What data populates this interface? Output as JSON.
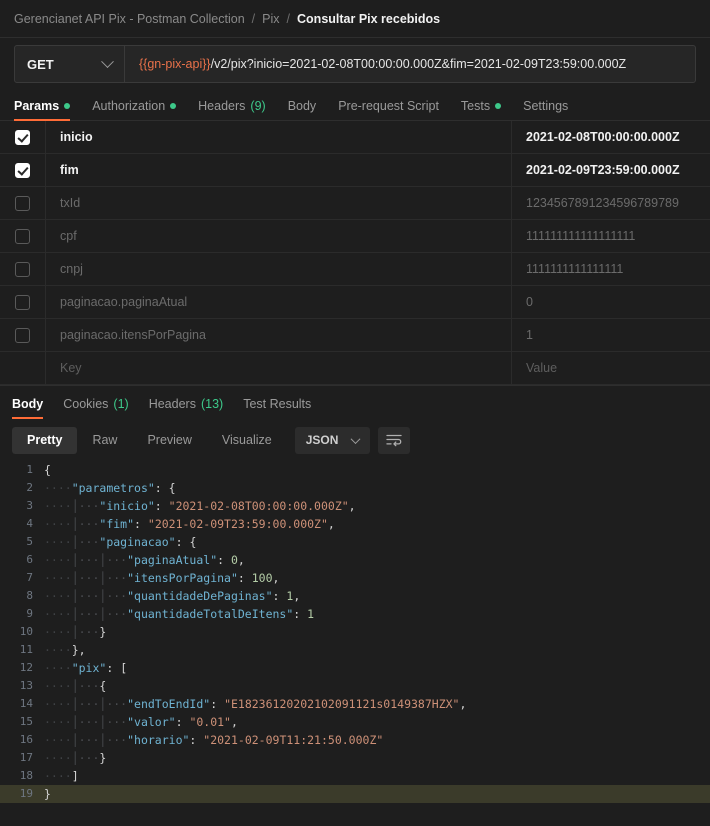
{
  "breadcrumb": {
    "collection": "Gerencianet API Pix - Postman Collection",
    "folder": "Pix",
    "request": "Consultar Pix recebidos",
    "separator": "/"
  },
  "request_bar": {
    "method": "GET",
    "url_variable": "{{gn-pix-api}}",
    "url_path": "/v2/pix?inicio=2021-02-08T00:00:00.000Z&fim=2021-02-09T23:59:00.000Z",
    "accent_color": "#ff6c37",
    "variable_color": "#e8714a"
  },
  "request_tabs": [
    {
      "label": "Params",
      "dot": true,
      "count": "",
      "active": true
    },
    {
      "label": "Authorization",
      "dot": true,
      "count": "",
      "active": false
    },
    {
      "label": "Headers",
      "dot": false,
      "count": "(9)",
      "active": false
    },
    {
      "label": "Body",
      "dot": false,
      "count": "",
      "active": false
    },
    {
      "label": "Pre-request Script",
      "dot": false,
      "count": "",
      "active": false
    },
    {
      "label": "Tests",
      "dot": true,
      "count": "",
      "active": false
    },
    {
      "label": "Settings",
      "dot": false,
      "count": "",
      "active": false
    }
  ],
  "params_table": {
    "rows": [
      {
        "checked": true,
        "key": "inicio",
        "value": "2021-02-08T00:00:00.000Z",
        "enabled": true
      },
      {
        "checked": true,
        "key": "fim",
        "value": "2021-02-09T23:59:00.000Z",
        "enabled": true
      },
      {
        "checked": false,
        "key": "txId",
        "value": "1234567891234596789789",
        "enabled": false
      },
      {
        "checked": false,
        "key": "cpf",
        "value": "111111111111111111",
        "enabled": false
      },
      {
        "checked": false,
        "key": "cnpj",
        "value": "1111111111111111",
        "enabled": false
      },
      {
        "checked": false,
        "key": "paginacao.paginaAtual",
        "value": "0",
        "enabled": false
      },
      {
        "checked": false,
        "key": "paginacao.itensPorPagina",
        "value": "1",
        "enabled": false
      }
    ],
    "placeholder_row": {
      "key": "Key",
      "value": "Value"
    }
  },
  "response_tabs": [
    {
      "label": "Body",
      "count": "",
      "active": true
    },
    {
      "label": "Cookies",
      "count": "(1)",
      "active": false
    },
    {
      "label": "Headers",
      "count": "(13)",
      "active": false
    },
    {
      "label": "Test Results",
      "count": "",
      "active": false
    }
  ],
  "body_toolbar": {
    "views": [
      {
        "label": "Pretty",
        "active": true
      },
      {
        "label": "Raw",
        "active": false
      },
      {
        "label": "Preview",
        "active": false
      },
      {
        "label": "Visualize",
        "active": false
      }
    ],
    "format": "JSON",
    "wrap_icon": "word-wrap-icon"
  },
  "response_body": {
    "language": "json",
    "active_line": 19,
    "lines": [
      {
        "n": 1,
        "indent": 0,
        "tokens": [
          {
            "t": "brace",
            "v": "{"
          }
        ]
      },
      {
        "n": 2,
        "indent": 1,
        "tokens": [
          {
            "t": "key",
            "v": "\"parametros\""
          },
          {
            "t": "punc",
            "v": ": "
          },
          {
            "t": "brace",
            "v": "{"
          }
        ]
      },
      {
        "n": 3,
        "indent": 2,
        "tokens": [
          {
            "t": "key",
            "v": "\"inicio\""
          },
          {
            "t": "punc",
            "v": ": "
          },
          {
            "t": "str",
            "v": "\"2021-02-08T00:00:00.000Z\""
          },
          {
            "t": "punc",
            "v": ","
          }
        ]
      },
      {
        "n": 4,
        "indent": 2,
        "tokens": [
          {
            "t": "key",
            "v": "\"fim\""
          },
          {
            "t": "punc",
            "v": ": "
          },
          {
            "t": "str",
            "v": "\"2021-02-09T23:59:00.000Z\""
          },
          {
            "t": "punc",
            "v": ","
          }
        ]
      },
      {
        "n": 5,
        "indent": 2,
        "tokens": [
          {
            "t": "key",
            "v": "\"paginacao\""
          },
          {
            "t": "punc",
            "v": ": "
          },
          {
            "t": "brace",
            "v": "{"
          }
        ]
      },
      {
        "n": 6,
        "indent": 3,
        "tokens": [
          {
            "t": "key",
            "v": "\"paginaAtual\""
          },
          {
            "t": "punc",
            "v": ": "
          },
          {
            "t": "num",
            "v": "0"
          },
          {
            "t": "punc",
            "v": ","
          }
        ]
      },
      {
        "n": 7,
        "indent": 3,
        "tokens": [
          {
            "t": "key",
            "v": "\"itensPorPagina\""
          },
          {
            "t": "punc",
            "v": ": "
          },
          {
            "t": "num",
            "v": "100"
          },
          {
            "t": "punc",
            "v": ","
          }
        ]
      },
      {
        "n": 8,
        "indent": 3,
        "tokens": [
          {
            "t": "key",
            "v": "\"quantidadeDePaginas\""
          },
          {
            "t": "punc",
            "v": ": "
          },
          {
            "t": "num",
            "v": "1"
          },
          {
            "t": "punc",
            "v": ","
          }
        ]
      },
      {
        "n": 9,
        "indent": 3,
        "tokens": [
          {
            "t": "key",
            "v": "\"quantidadeTotalDeItens\""
          },
          {
            "t": "punc",
            "v": ": "
          },
          {
            "t": "num",
            "v": "1"
          }
        ]
      },
      {
        "n": 10,
        "indent": 2,
        "tokens": [
          {
            "t": "brace",
            "v": "}"
          }
        ]
      },
      {
        "n": 11,
        "indent": 1,
        "tokens": [
          {
            "t": "brace",
            "v": "}"
          },
          {
            "t": "punc",
            "v": ","
          }
        ]
      },
      {
        "n": 12,
        "indent": 1,
        "tokens": [
          {
            "t": "key",
            "v": "\"pix\""
          },
          {
            "t": "punc",
            "v": ": "
          },
          {
            "t": "brace",
            "v": "["
          }
        ]
      },
      {
        "n": 13,
        "indent": 2,
        "tokens": [
          {
            "t": "brace",
            "v": "{"
          }
        ]
      },
      {
        "n": 14,
        "indent": 3,
        "tokens": [
          {
            "t": "key",
            "v": "\"endToEndId\""
          },
          {
            "t": "punc",
            "v": ": "
          },
          {
            "t": "str",
            "v": "\"E18236120202102091121s0149387HZX\""
          },
          {
            "t": "punc",
            "v": ","
          }
        ]
      },
      {
        "n": 15,
        "indent": 3,
        "tokens": [
          {
            "t": "key",
            "v": "\"valor\""
          },
          {
            "t": "punc",
            "v": ": "
          },
          {
            "t": "str",
            "v": "\"0.01\""
          },
          {
            "t": "punc",
            "v": ","
          }
        ]
      },
      {
        "n": 16,
        "indent": 3,
        "tokens": [
          {
            "t": "key",
            "v": "\"horario\""
          },
          {
            "t": "punc",
            "v": ": "
          },
          {
            "t": "str",
            "v": "\"2021-02-09T11:21:50.000Z\""
          }
        ]
      },
      {
        "n": 17,
        "indent": 2,
        "tokens": [
          {
            "t": "brace",
            "v": "}"
          }
        ]
      },
      {
        "n": 18,
        "indent": 1,
        "tokens": [
          {
            "t": "brace",
            "v": "]"
          }
        ]
      },
      {
        "n": 19,
        "indent": 0,
        "tokens": [
          {
            "t": "brace",
            "v": "}"
          }
        ]
      }
    ]
  },
  "colors": {
    "accent": "#ff6c37",
    "green": "#3dc98a",
    "json_key": "#6fb3d2",
    "json_string": "#ce9178",
    "json_number": "#b5cea8",
    "active_line": "#3b3b2a"
  }
}
